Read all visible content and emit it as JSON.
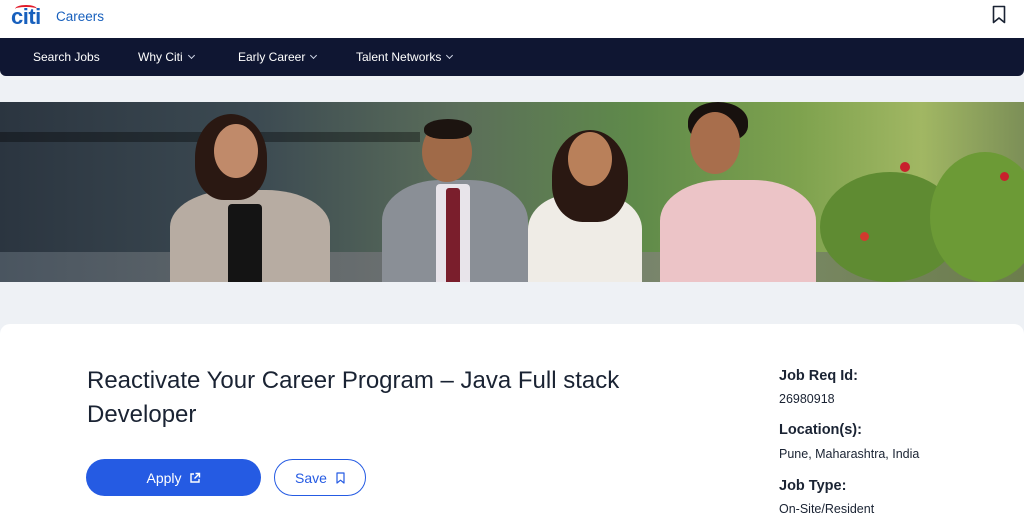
{
  "header": {
    "logo_text": "citi",
    "brand_label": "Careers",
    "bookmark_icon": "bookmark-icon"
  },
  "nav": {
    "items": [
      {
        "label": "Search Jobs",
        "has_dropdown": false
      },
      {
        "label": "Why Citi",
        "has_dropdown": true
      },
      {
        "label": "Early Career",
        "has_dropdown": true
      },
      {
        "label": "Talent Networks",
        "has_dropdown": true
      }
    ]
  },
  "job": {
    "title": "Reactivate Your Career Program – Java Full stack Developer",
    "apply_label": "Apply",
    "apply_icon": "external-link-icon",
    "save_label": "Save",
    "save_icon": "bookmark-icon"
  },
  "details": {
    "req_id_label": "Job Req Id:",
    "req_id_value": "26980918",
    "location_label": "Location(s):",
    "location_value": "Pune, Maharashtra, India",
    "job_type_label": "Job Type:",
    "job_type_value": "On-Site/Resident"
  },
  "colors": {
    "brand_blue": "#1860bd",
    "nav_bg": "#0f1632",
    "primary_button": "#255be3",
    "logo_arc": "#e21b2a"
  }
}
